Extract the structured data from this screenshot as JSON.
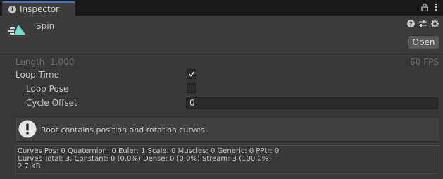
{
  "tab": {
    "label": "Inspector"
  },
  "asset": {
    "name": "Spin"
  },
  "header": {
    "open_label": "Open"
  },
  "clip": {
    "length_label": "Length",
    "length_value": "1.000",
    "fps": "60 FPS",
    "loop_time_label": "Loop Time",
    "loop_time_checked": true,
    "loop_pose_label": "Loop Pose",
    "loop_pose_checked": false,
    "cycle_offset_label": "Cycle Offset",
    "cycle_offset_value": "0"
  },
  "help": {
    "text": "Root contains position and rotation curves"
  },
  "stats": {
    "line1": "Curves Pos: 0 Quaternion: 0 Euler: 1 Scale: 0 Muscles: 0 Generic: 0 PPtr: 0",
    "line2": "Curves Total: 3, Constant: 0 (0.0%) Dense: 0 (0.0%) Stream: 3 (100.0%)",
    "line3": "2.7 KB"
  },
  "colors": {
    "accent": "#3a79bb",
    "anim_icon": "#6ee0d0"
  }
}
